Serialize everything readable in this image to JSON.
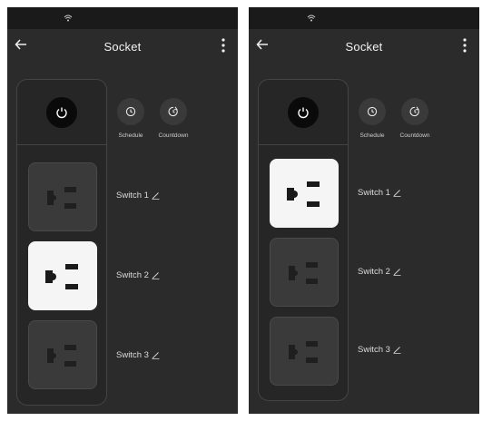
{
  "screens": [
    {
      "title": "Socket",
      "actions": [
        {
          "label": "Schedule",
          "icon": "clock-icon"
        },
        {
          "label": "Countdown",
          "icon": "countdown-icon"
        }
      ],
      "switches": [
        {
          "label": "Switch 1",
          "on": false
        },
        {
          "label": "Switch 2",
          "on": true
        },
        {
          "label": "Switch 3",
          "on": false
        }
      ]
    },
    {
      "title": "Socket",
      "actions": [
        {
          "label": "Schedule",
          "icon": "clock-icon"
        },
        {
          "label": "Countdown",
          "icon": "countdown-icon"
        }
      ],
      "switches": [
        {
          "label": "Switch 1",
          "on": true
        },
        {
          "label": "Switch 2",
          "on": false
        },
        {
          "label": "Switch 3",
          "on": false
        }
      ]
    }
  ],
  "colors": {
    "background": "#2b2b2b",
    "status_bar": "#1a1a1a",
    "outlet_on": "#f5f5f5",
    "outlet_off": "#3a3a3a",
    "power_button": "#0a0a0a"
  }
}
